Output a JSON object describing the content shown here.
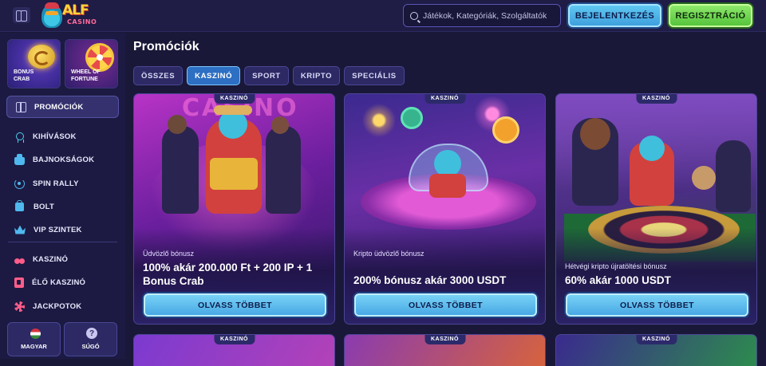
{
  "header": {
    "logo_text": "ALF",
    "logo_sub": "CASINO",
    "search_placeholder": "Játékok, Kategóriák, Szolgáltatók",
    "login_label": "BEJELENTKEZÉS",
    "register_label": "REGISZTRÁCIÓ"
  },
  "sidebar": {
    "features": [
      {
        "label": "BONUS\nCRAB",
        "icon": "crab-icon"
      },
      {
        "label": "WHEEL OF\nFORTUNE",
        "icon": "wheel-icon"
      }
    ],
    "active_item": {
      "label": "PROMÓCIÓK",
      "icon": "gift-icon"
    },
    "group1": [
      {
        "label": "KIHÍVÁSOK",
        "icon": "medal-icon"
      },
      {
        "label": "BAJNOKSÁGOK",
        "icon": "trophy-icon"
      },
      {
        "label": "SPIN RALLY",
        "icon": "spin-icon"
      },
      {
        "label": "BOLT",
        "icon": "bag-icon"
      },
      {
        "label": "VIP SZINTEK",
        "icon": "crown-icon"
      }
    ],
    "group2": [
      {
        "label": "KASZINÓ",
        "icon": "cherry-icon"
      },
      {
        "label": "ÉLŐ KASZINÓ",
        "icon": "live-icon"
      },
      {
        "label": "JACKPOTOK",
        "icon": "jackpot-icon"
      }
    ],
    "language_label": "MAGYAR",
    "help_label": "SÚGÓ",
    "help_glyph": "?"
  },
  "main": {
    "title": "Promóciók",
    "tabs": [
      {
        "label": "ÖSSZES",
        "active": false
      },
      {
        "label": "KASZINÓ",
        "active": true
      },
      {
        "label": "SPORT",
        "active": false
      },
      {
        "label": "KRIPTO",
        "active": false
      },
      {
        "label": "SPECIÁLIS",
        "active": false
      }
    ],
    "cards": [
      {
        "badge": "KASZINÓ",
        "subtitle": "Üdvözlő bónusz",
        "title": "100% akár 200.000 Ft + 200 IP + 1 Bonus Crab",
        "button": "OLVASS TÖBBET",
        "art_text": "CASINO"
      },
      {
        "badge": "KASZINÓ",
        "subtitle": "Kripto üdvözlő bónusz",
        "title": "200% bónusz akár 3000 USDT",
        "button": "OLVASS TÖBBET"
      },
      {
        "badge": "KASZINÓ",
        "subtitle": "Hétvégi kripto újratöltési bónusz",
        "title": "60% akár 1000 USDT",
        "button": "OLVASS TÖBBET"
      }
    ],
    "peek_cards": [
      {
        "badge": "KASZINÓ"
      },
      {
        "badge": "KASZINÓ"
      },
      {
        "badge": "KASZINÓ"
      }
    ]
  },
  "colors": {
    "background": "#1a1838",
    "accent_blue": "#48a8e4",
    "accent_green": "#55c43c",
    "logo_yellow": "#ffd33a"
  }
}
